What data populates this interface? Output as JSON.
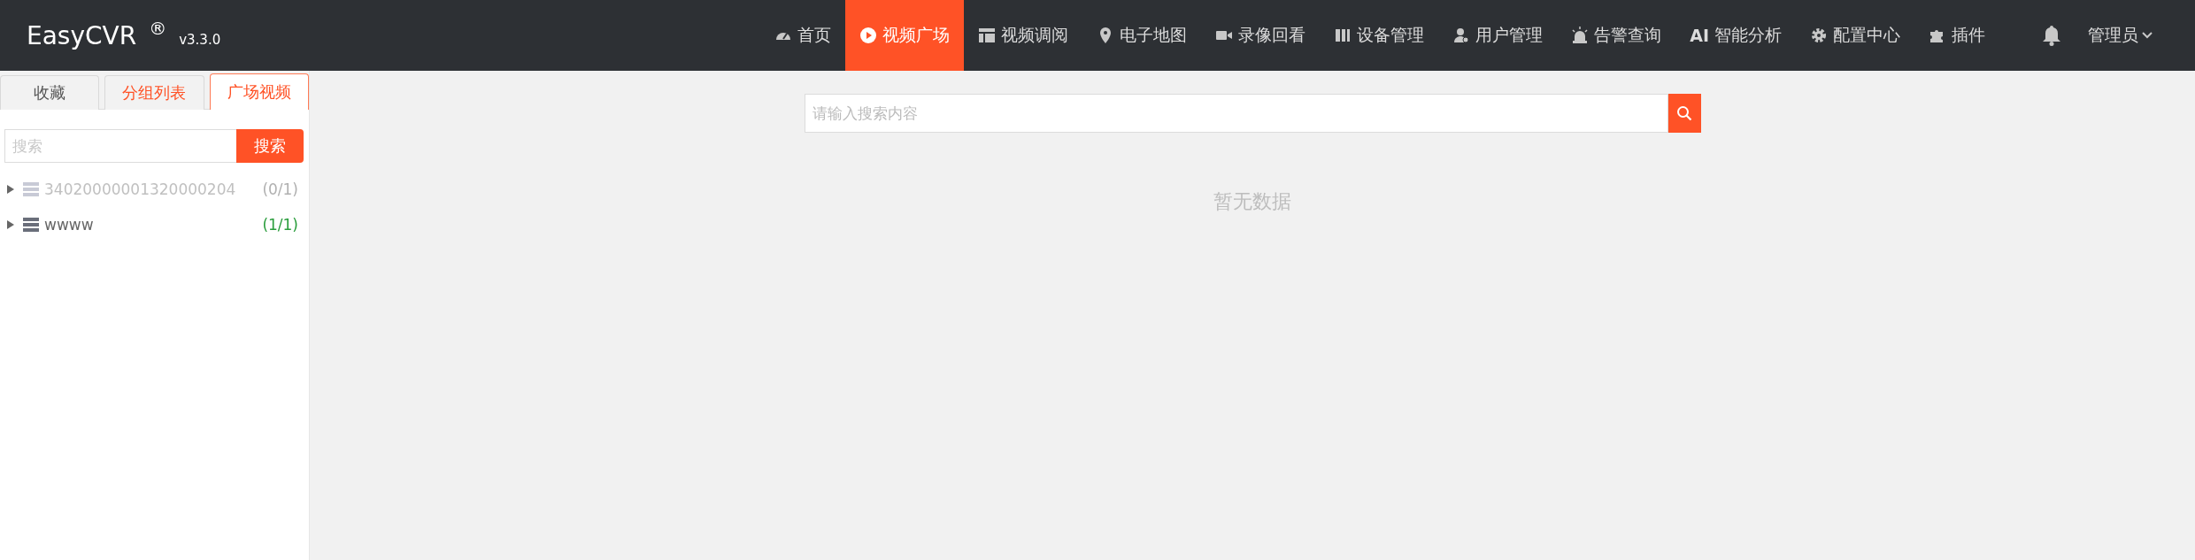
{
  "header": {
    "logo": "EasyCVR",
    "registered_mark": "®",
    "version": "v3.3.0",
    "nav": [
      {
        "label": "首页",
        "selected": false
      },
      {
        "label": "视频广场",
        "selected": true
      },
      {
        "label": "视频调阅",
        "selected": false
      },
      {
        "label": "电子地图",
        "selected": false
      },
      {
        "label": "录像回看",
        "selected": false
      },
      {
        "label": "设备管理",
        "selected": false
      },
      {
        "label": "用户管理",
        "selected": false
      },
      {
        "label": "告警查询",
        "selected": false
      },
      {
        "label": "智能分析",
        "badge": "AI",
        "selected": false
      },
      {
        "label": "配置中心",
        "selected": false
      },
      {
        "label": "插件",
        "selected": false
      }
    ],
    "user": "管理员"
  },
  "sidebar": {
    "tabs": [
      {
        "label": "收藏",
        "selected": false
      },
      {
        "label": "分组列表",
        "selected": false
      },
      {
        "label": "广场视频",
        "selected": true
      }
    ],
    "search": {
      "placeholder": "搜索",
      "button": "搜索"
    },
    "tree": [
      {
        "name": "34020000001320000204",
        "count": "(0/1)",
        "online": false,
        "expanded": false
      },
      {
        "name": "wwww",
        "count": "(1/1)",
        "online": true,
        "expanded": false
      }
    ]
  },
  "main": {
    "search": {
      "placeholder": "请输入搜索内容"
    },
    "empty_text": "暂无数据"
  }
}
